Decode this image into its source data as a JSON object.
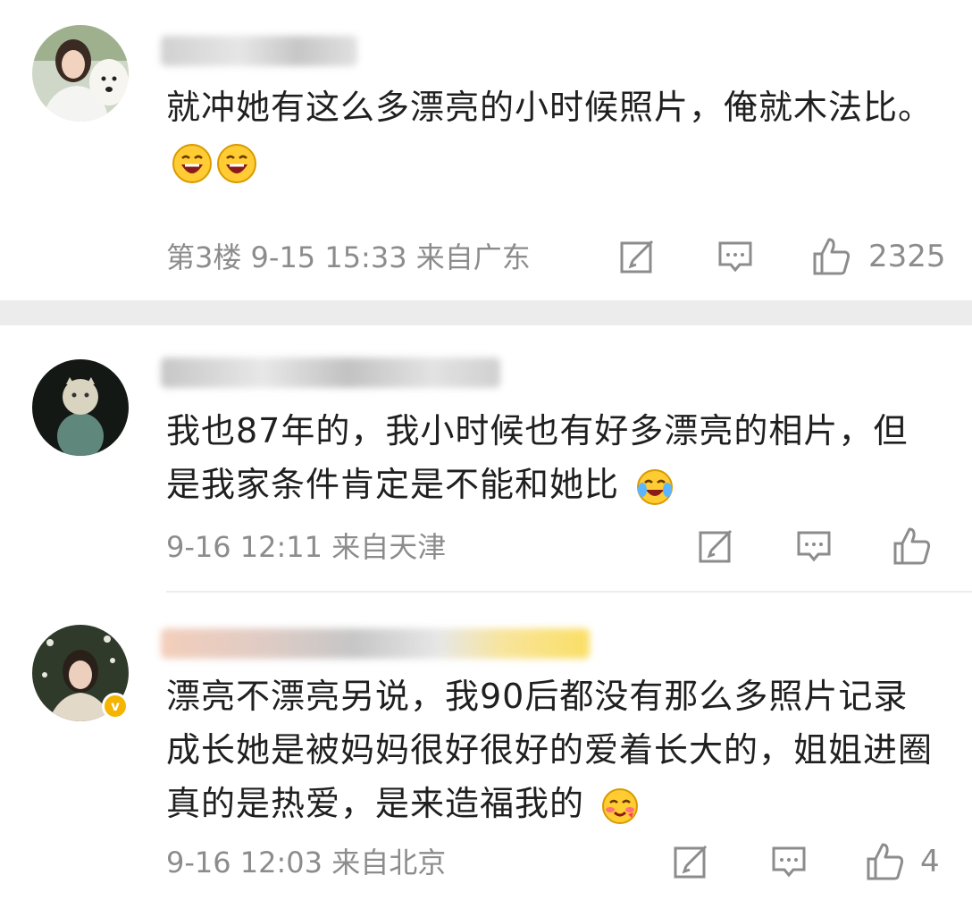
{
  "comments": [
    {
      "text": "就冲她有这么多漂亮的小时候照片，俺就木法比。",
      "meta": "第3楼 9-15 15:33 来自广东",
      "likes": "2325"
    },
    {
      "text": "我也87年的，我小时候也有好多漂亮的相片，但是我家条件肯定是不能和她比",
      "meta": "9-16 12:11 来自天津",
      "likes": ""
    },
    {
      "text": "漂亮不漂亮另说，我90后都没有那么多照片记录成长她是被妈妈很好很好的爱着长大的，姐姐进圈真的是热爱，是来造福我的",
      "meta": "9-16 12:03 来自北京",
      "likes": "4"
    }
  ],
  "icons": {
    "repost": "repost-icon",
    "comment": "comment-icon",
    "like": "like-icon",
    "verified": "verified-badge-icon"
  },
  "colors": {
    "text": "#1f1f1f",
    "meta": "#8c8c8c",
    "separator": "#ececec",
    "verified": "#f5b400"
  }
}
